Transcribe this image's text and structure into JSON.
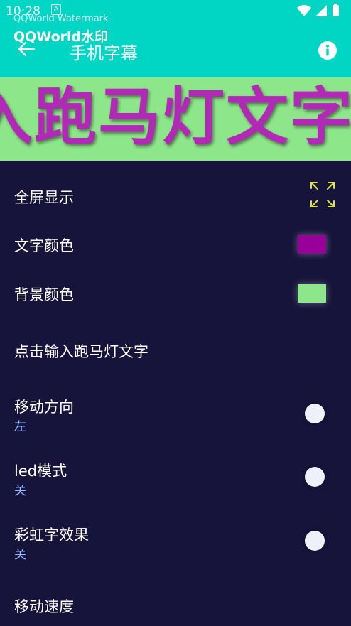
{
  "status_bar": {
    "time": "10:28",
    "notif": "A"
  },
  "watermark": {
    "line1": "QQWorld Watermark",
    "line2": "QQWorld水印"
  },
  "app_bar": {
    "title": "手机字幕",
    "back_icon": "arrow-left-icon",
    "info_icon": "info-icon"
  },
  "marquee": {
    "text": "入跑马灯文字",
    "text_color": "#b12ab5",
    "bg_color": "#8ee68a"
  },
  "settings": {
    "fullscreen": {
      "label": "全屏显示",
      "icon": "fullscreen-icon"
    },
    "text_color": {
      "label": "文字颜色",
      "value": "#990099"
    },
    "bg_color": {
      "label": "背景颜色",
      "value": "#8ee68a"
    },
    "input_text": {
      "label": "点击输入跑马灯文字"
    },
    "direction": {
      "label": "移动方向",
      "value": "左"
    },
    "led_mode": {
      "label": "led模式",
      "value": "关"
    },
    "rainbow": {
      "label": "彩虹字效果",
      "value": "关"
    },
    "speed": {
      "label": "移动速度"
    }
  },
  "colors": {
    "app_bar": "#00d6c3",
    "background": "#16143a",
    "accent_sub": "#9ab8ff",
    "fullscreen_icon": "#e0e23a"
  }
}
